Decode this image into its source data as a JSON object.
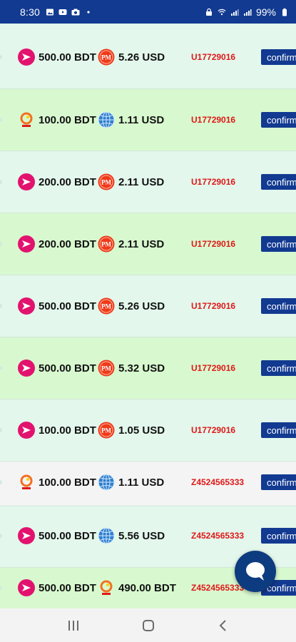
{
  "status_bar": {
    "time": "8:30",
    "left_icons": [
      "gallery-icon",
      "youtube-icon",
      "camera-icon",
      "dot-icon"
    ],
    "right_icons": [
      "lock-icon",
      "wifi-icon",
      "signal-icon",
      "signal-icon"
    ],
    "battery": "99%"
  },
  "colors": {
    "primary": "#123a91",
    "uid_text": "#e01818",
    "row_green_light": "#e3f7ec",
    "row_green": "#d8f9cf",
    "row_gray": "#f4f4f4"
  },
  "transactions": [
    {
      "from_icon": "bkash-icon",
      "from_amount": "500.00 BDT",
      "to_icon": "perfect-money-icon",
      "to_amount": "5.26 USD",
      "user_id": "U17729016",
      "action": "confirm"
    },
    {
      "from_icon": "upay-icon",
      "from_amount": "100.00 BDT",
      "to_icon": "webmoney-icon",
      "to_amount": "1.11 USD",
      "user_id": "U17729016",
      "action": "confirm"
    },
    {
      "from_icon": "bkash-icon",
      "from_amount": "200.00 BDT",
      "to_icon": "perfect-money-icon",
      "to_amount": "2.11 USD",
      "user_id": "U17729016",
      "action": "confirm"
    },
    {
      "from_icon": "bkash-icon",
      "from_amount": "200.00 BDT",
      "to_icon": "perfect-money-icon",
      "to_amount": "2.11 USD",
      "user_id": "U17729016",
      "action": "confirm"
    },
    {
      "from_icon": "bkash-icon",
      "from_amount": "500.00 BDT",
      "to_icon": "perfect-money-icon",
      "to_amount": "5.26 USD",
      "user_id": "U17729016",
      "action": "confirm"
    },
    {
      "from_icon": "bkash-icon",
      "from_amount": "500.00 BDT",
      "to_icon": "perfect-money-icon",
      "to_amount": "5.32 USD",
      "user_id": "U17729016",
      "action": "confirm"
    },
    {
      "from_icon": "bkash-icon",
      "from_amount": "100.00 BDT",
      "to_icon": "perfect-money-icon",
      "to_amount": "1.05 USD",
      "user_id": "U17729016",
      "action": "confirm"
    },
    {
      "from_icon": "upay-icon",
      "from_amount": "100.00 BDT",
      "to_icon": "webmoney-icon",
      "to_amount": "1.11 USD",
      "user_id": "Z4524565333",
      "action": "confirm"
    },
    {
      "from_icon": "bkash-icon",
      "from_amount": "500.00 BDT",
      "to_icon": "webmoney-icon",
      "to_amount": "5.56 USD",
      "user_id": "Z4524565333",
      "action": "confirm"
    },
    {
      "from_icon": "bkash-icon",
      "from_amount": "500.00 BDT",
      "to_icon": "upay-icon",
      "to_amount": "490.00 BDT",
      "user_id": "Z4524565333",
      "action": "confirm"
    }
  ],
  "chat": {
    "icon": "chat-bubble-icon"
  },
  "nav_bar": {
    "icons": [
      "recent-apps-icon",
      "home-icon",
      "back-icon"
    ]
  }
}
